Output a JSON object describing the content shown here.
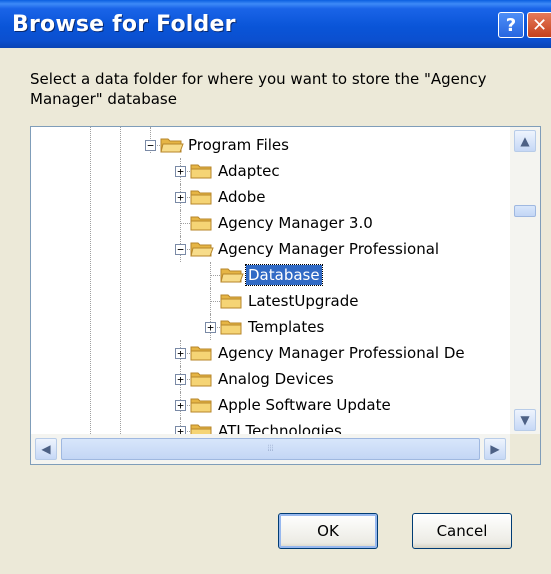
{
  "window": {
    "title": "Browse for Folder",
    "help_glyph": "?",
    "close_glyph": "✕"
  },
  "instructions": "Select a data folder for where you want to store the \"Agency Manager\" database",
  "tree": {
    "items": [
      {
        "label": "Program Files",
        "expander": "−",
        "selected": false
      },
      {
        "label": "Adaptec",
        "expander": "+",
        "selected": false
      },
      {
        "label": "Adobe",
        "expander": "+",
        "selected": false
      },
      {
        "label": "Agency Manager 3.0",
        "expander": "",
        "selected": false
      },
      {
        "label": "Agency Manager Professional",
        "expander": "−",
        "selected": false
      },
      {
        "label": "Database",
        "expander": "",
        "selected": true
      },
      {
        "label": "LatestUpgrade",
        "expander": "",
        "selected": false
      },
      {
        "label": "Templates",
        "expander": "+",
        "selected": false
      },
      {
        "label": "Agency Manager Professional De",
        "expander": "+",
        "selected": false
      },
      {
        "label": "Analog Devices",
        "expander": "+",
        "selected": false
      },
      {
        "label": "Apple Software Update",
        "expander": "+",
        "selected": false
      },
      {
        "label": "ATI Technologies",
        "expander": "+",
        "selected": false
      }
    ]
  },
  "scrollbar": {
    "up": "▲",
    "down": "▼",
    "left": "◀",
    "right": "▶",
    "grip": "⦙⦙⦙"
  },
  "buttons": {
    "ok": "OK",
    "cancel": "Cancel"
  },
  "colors": {
    "titlebar": "#0a55d8",
    "selection": "#316ac5",
    "dialog": "#ece9d8"
  }
}
